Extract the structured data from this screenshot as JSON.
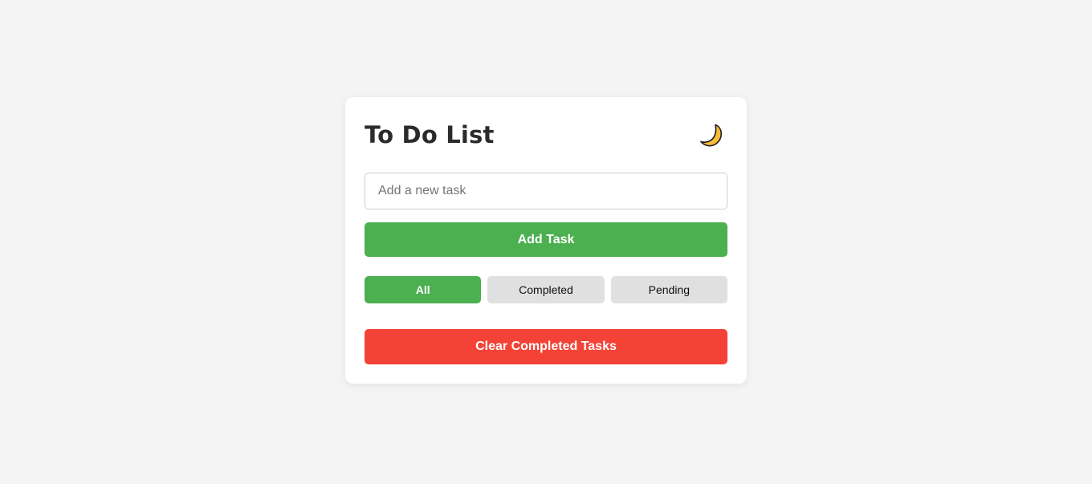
{
  "app": {
    "title": "To Do List",
    "theme_toggle_icon": "moon-icon"
  },
  "input": {
    "placeholder": "Add a new task",
    "value": ""
  },
  "buttons": {
    "add_label": "Add Task",
    "clear_label": "Clear Completed Tasks"
  },
  "filters": [
    {
      "label": "All",
      "active": true
    },
    {
      "label": "Completed",
      "active": false
    },
    {
      "label": "Pending",
      "active": false
    }
  ],
  "tasks": [],
  "colors": {
    "primary": "#4caf50",
    "danger": "#f44336",
    "filter_inactive": "#e0e0e0",
    "background": "#f4f4f4",
    "card": "#ffffff",
    "moon": "#f6bd3a"
  }
}
